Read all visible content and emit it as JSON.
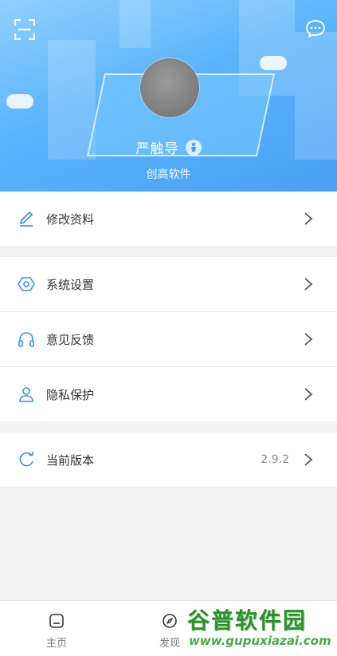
{
  "header": {
    "username": "严触导",
    "subtitle": "创高软件",
    "scan_icon": "scan-icon",
    "chat_icon": "chat-bubble-icon"
  },
  "menu": {
    "group1": [
      {
        "label": "修改资料",
        "icon": "edit-pen-icon"
      }
    ],
    "group2": [
      {
        "label": "系统设置",
        "icon": "settings-hex-icon"
      },
      {
        "label": "意见反馈",
        "icon": "headphones-icon"
      },
      {
        "label": "隐私保护",
        "icon": "person-icon"
      }
    ],
    "group3": [
      {
        "label": "当前版本",
        "value": "2.9.2",
        "icon": "refresh-icon"
      }
    ]
  },
  "tabbar": {
    "home": "主页",
    "discover": "发现"
  },
  "watermark": {
    "brand": "谷普软件园",
    "url": "www.gupuxiazai.com"
  },
  "colors": {
    "accent": "#4a9ff5",
    "icon_blue": "#3a8ee6",
    "background": "#f2f2f2"
  }
}
